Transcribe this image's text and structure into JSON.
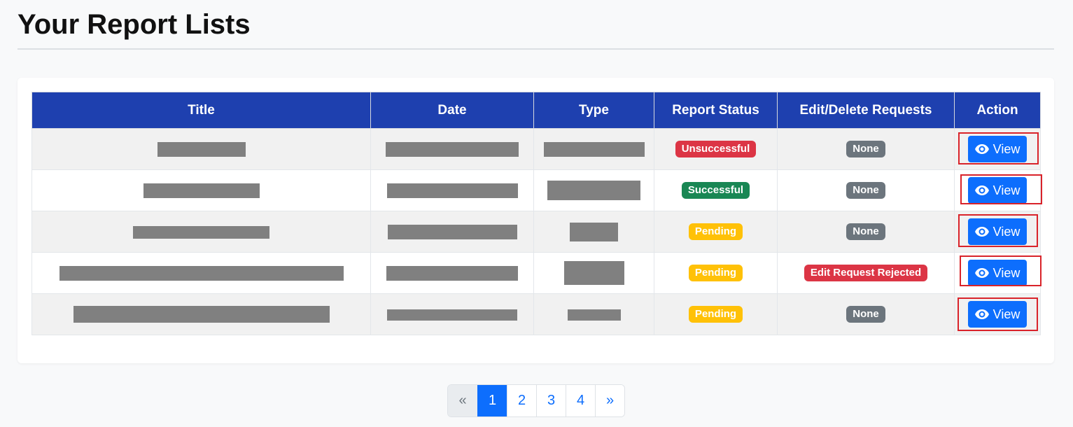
{
  "page": {
    "title": "Your Report Lists"
  },
  "table": {
    "columns": [
      "Title",
      "Date",
      "Type",
      "Report Status",
      "Edit/Delete Requests",
      "Action"
    ],
    "rows": [
      {
        "status": "Unsuccessful",
        "status_color": "#dc3545",
        "request": "None",
        "request_color": "#6c757d",
        "action": "View"
      },
      {
        "status": "Successful",
        "status_color": "#198754",
        "request": "None",
        "request_color": "#6c757d",
        "action": "View"
      },
      {
        "status": "Pending",
        "status_color": "#ffc107",
        "request": "None",
        "request_color": "#6c757d",
        "action": "View"
      },
      {
        "status": "Pending",
        "status_color": "#ffc107",
        "request": "Edit Request Rejected",
        "request_color": "#dc3545",
        "action": "View"
      },
      {
        "status": "Pending",
        "status_color": "#ffc107",
        "request": "None",
        "request_color": "#6c757d",
        "action": "View"
      }
    ]
  },
  "pagination": {
    "prev": "«",
    "pages": [
      "1",
      "2",
      "3",
      "4"
    ],
    "active_page": "1",
    "next": "»"
  },
  "colors": {
    "header_bg": "#1e40af",
    "primary": "#0d6efd",
    "highlight": "#d9232a"
  },
  "icons": {
    "view_button_icon": "eye-icon"
  }
}
